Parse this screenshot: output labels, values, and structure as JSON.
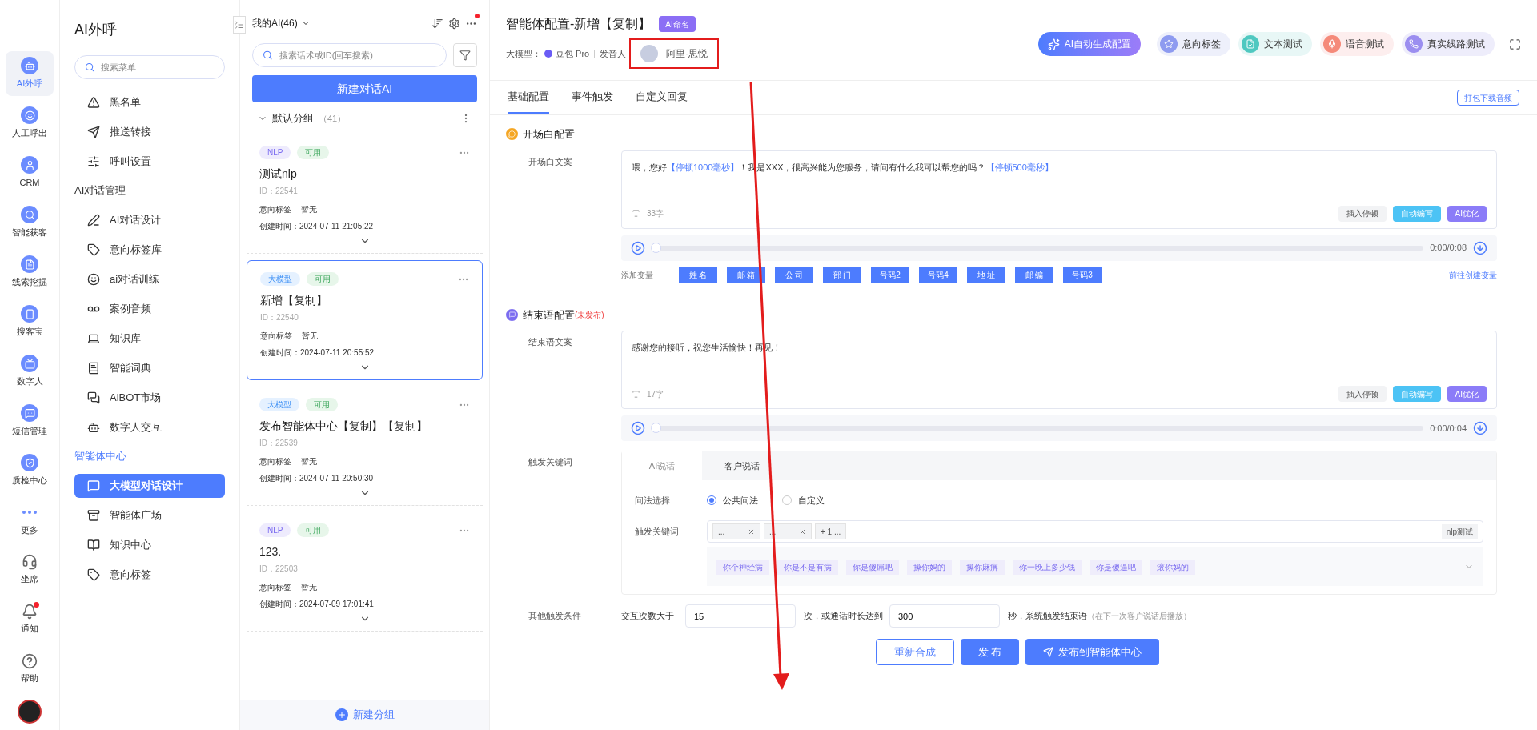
{
  "nav_rail": {
    "items": [
      {
        "label": "AI外呼",
        "selected": true,
        "badge": false
      },
      {
        "label": "人工呼出",
        "selected": false,
        "badge": false
      },
      {
        "label": "CRM",
        "selected": false,
        "badge": false
      },
      {
        "label": "智能获客",
        "selected": false,
        "badge": false
      },
      {
        "label": "线索挖掘",
        "selected": false,
        "badge": false
      },
      {
        "label": "搜客宝",
        "selected": false,
        "badge": false
      },
      {
        "label": "数字人",
        "selected": false,
        "badge": false
      },
      {
        "label": "短信管理",
        "selected": false,
        "badge": false
      },
      {
        "label": "质检中心",
        "selected": false,
        "badge": false
      },
      {
        "label": "更多",
        "selected": false,
        "badge": false
      },
      {
        "label": "坐席",
        "selected": false,
        "badge": false
      },
      {
        "label": "通知",
        "selected": false,
        "badge": true
      },
      {
        "label": "帮助",
        "selected": false,
        "badge": false
      }
    ]
  },
  "sidebar": {
    "title": "AI外呼",
    "search": {
      "placeholder": "搜索菜单"
    },
    "groups": [
      {
        "items": [
          {
            "label": "黑名单",
            "selected": false
          },
          {
            "label": "推送转接",
            "selected": false
          },
          {
            "label": "呼叫设置",
            "selected": false
          }
        ]
      },
      {
        "heading": "AI对话管理",
        "active": false,
        "items": [
          {
            "label": "AI对话设计",
            "selected": false
          },
          {
            "label": "意向标签库",
            "selected": false
          },
          {
            "label": "ai对话训练",
            "selected": false
          },
          {
            "label": "案例音频",
            "selected": false
          },
          {
            "label": "知识库",
            "selected": false
          },
          {
            "label": "智能词典",
            "selected": false
          },
          {
            "label": "AiBOT市场",
            "selected": false
          },
          {
            "label": "数字人交互",
            "selected": false
          }
        ]
      },
      {
        "heading": "智能体中心",
        "active": true,
        "items": [
          {
            "label": "大模型对话设计",
            "selected": true
          },
          {
            "label": "智能体广场",
            "selected": false
          },
          {
            "label": "知识中心",
            "selected": false
          },
          {
            "label": "意向标签",
            "selected": false
          }
        ]
      }
    ]
  },
  "ai_list": {
    "title": "我的AI(46)",
    "settings_badge": true,
    "search": {
      "placeholder": "搜索话术或ID(回车搜索)"
    },
    "new_button": "新建对话AI",
    "group": {
      "name": "默认分组",
      "count": "（41）",
      "expanded": true
    },
    "cards": [
      {
        "tag": {
          "kind": "nlp",
          "label": "NLP"
        },
        "status": "可用",
        "title": "测试nlp",
        "id": "ID：22541",
        "intent_label": "意向标签",
        "intent_value": "暂无",
        "created_label": "创建时间：",
        "created": "2024-07-11 21:05:22",
        "selected": false
      },
      {
        "tag": {
          "kind": "llm",
          "label": "大模型"
        },
        "status": "可用",
        "title": "新增【复制】",
        "id": "ID：22540",
        "intent_label": "意向标签",
        "intent_value": "暂无",
        "created_label": "创建时间：",
        "created": "2024-07-11 20:55:52",
        "selected": true
      },
      {
        "tag": {
          "kind": "llm",
          "label": "大模型"
        },
        "status": "可用",
        "title": "发布智能体中心【复制】【复制】",
        "id": "ID：22539",
        "intent_label": "意向标签",
        "intent_value": "暂无",
        "created_label": "创建时间：",
        "created": "2024-07-11 20:50:30",
        "selected": false
      },
      {
        "tag": {
          "kind": "nlp",
          "label": "NLP"
        },
        "status": "可用",
        "title": "123.",
        "id": "ID：22503",
        "intent_label": "意向标签",
        "intent_value": "暂无",
        "created_label": "创建时间：",
        "created": "2024-07-09 17:01:41",
        "selected": false
      }
    ],
    "footer_button": "新建分组"
  },
  "main": {
    "title": "智能体配置-新增【复制】",
    "title_badge": "AI命名",
    "model_label": "大模型：",
    "model": "豆包 Pro",
    "speaker_label": "发音人",
    "speaker": "阿里-思悦",
    "toolbar": [
      {
        "kind": "primary",
        "label": "AI自动生成配置"
      },
      {
        "kind": "chip",
        "label": "意向标签"
      },
      {
        "kind": "chip",
        "label": "文本测试"
      },
      {
        "kind": "chip",
        "label": "语音测试"
      },
      {
        "kind": "chip",
        "label": "真实线路测试"
      }
    ],
    "tabs": [
      {
        "label": "基础配置",
        "selected": true
      },
      {
        "label": "事件触发",
        "selected": false
      },
      {
        "label": "自定义回复",
        "selected": false
      }
    ],
    "download_button": "打包下载音频",
    "opening": {
      "heading": "开场白配置",
      "field_label": "开场白文案",
      "segments": [
        {
          "kind": "text",
          "text": "喂，您好"
        },
        {
          "kind": "pause",
          "text": "【停顿1000毫秒】"
        },
        {
          "kind": "text",
          "text": "！我是XXX，很高兴能为您服务，请问有什么我可以帮您的吗？"
        },
        {
          "kind": "pause",
          "text": "【停顿500毫秒】"
        }
      ],
      "count": "33字",
      "buttons": [
        "插入停顿",
        "自动编写",
        "AI优化"
      ],
      "audio": {
        "level": 0,
        "time": "0:00/0:08"
      },
      "variables_label": "添加变量",
      "variables": [
        "姓 名",
        "邮 箱",
        "公 司",
        "部 门",
        "号码2",
        "号码4",
        "地 址",
        "邮 编",
        "号码3"
      ],
      "variables_link": "前往创建变量"
    },
    "closing": {
      "heading": "结束语配置",
      "status": "(未发布)",
      "field_label": "结束语文案",
      "text": "感谢您的接听，祝您生活愉快！再见！",
      "count": "17字",
      "buttons": [
        "插入停顿",
        "自动编写",
        "AI优化"
      ],
      "audio": {
        "level": 0,
        "time": "0:00/0:04"
      }
    },
    "trigger": {
      "label": "触发关键词",
      "tabs": [
        {
          "label": "AI说话",
          "selected": true
        },
        {
          "label": "客户说话",
          "selected": false
        }
      ],
      "method_label": "问法选择",
      "methods": [
        {
          "label": "公共问法",
          "selected": true
        },
        {
          "label": "自定义",
          "selected": false
        }
      ],
      "keywords_label": "触发关键词",
      "keywords": [
        {
          "kind": "tag",
          "text": "..."
        },
        {
          "kind": "tag",
          "text": "..."
        },
        {
          "kind": "more",
          "text": "+ 1 ..."
        }
      ],
      "test_button": "nlp测试",
      "suggestions": [
        "你个神经病",
        "你是不是有病",
        "你是傻屌吧",
        "操你妈的",
        "操你麻痹",
        "你一晚上多少钱",
        "你是傻逼吧",
        "滚你妈的"
      ]
    },
    "other": {
      "label": "其他触发条件",
      "prefix": "交互次数大于",
      "count_value": "15",
      "middle": "次，或通话时长达到",
      "seconds_value": "300",
      "suffix": "秒，系统触发结束语",
      "note": "（在下一次客户说话后播放）"
    },
    "actions": [
      {
        "kind": "outline",
        "label": "重新合成"
      },
      {
        "kind": "primary",
        "label": "发 布"
      },
      {
        "kind": "send",
        "label": "发布到智能体中心"
      }
    ]
  }
}
